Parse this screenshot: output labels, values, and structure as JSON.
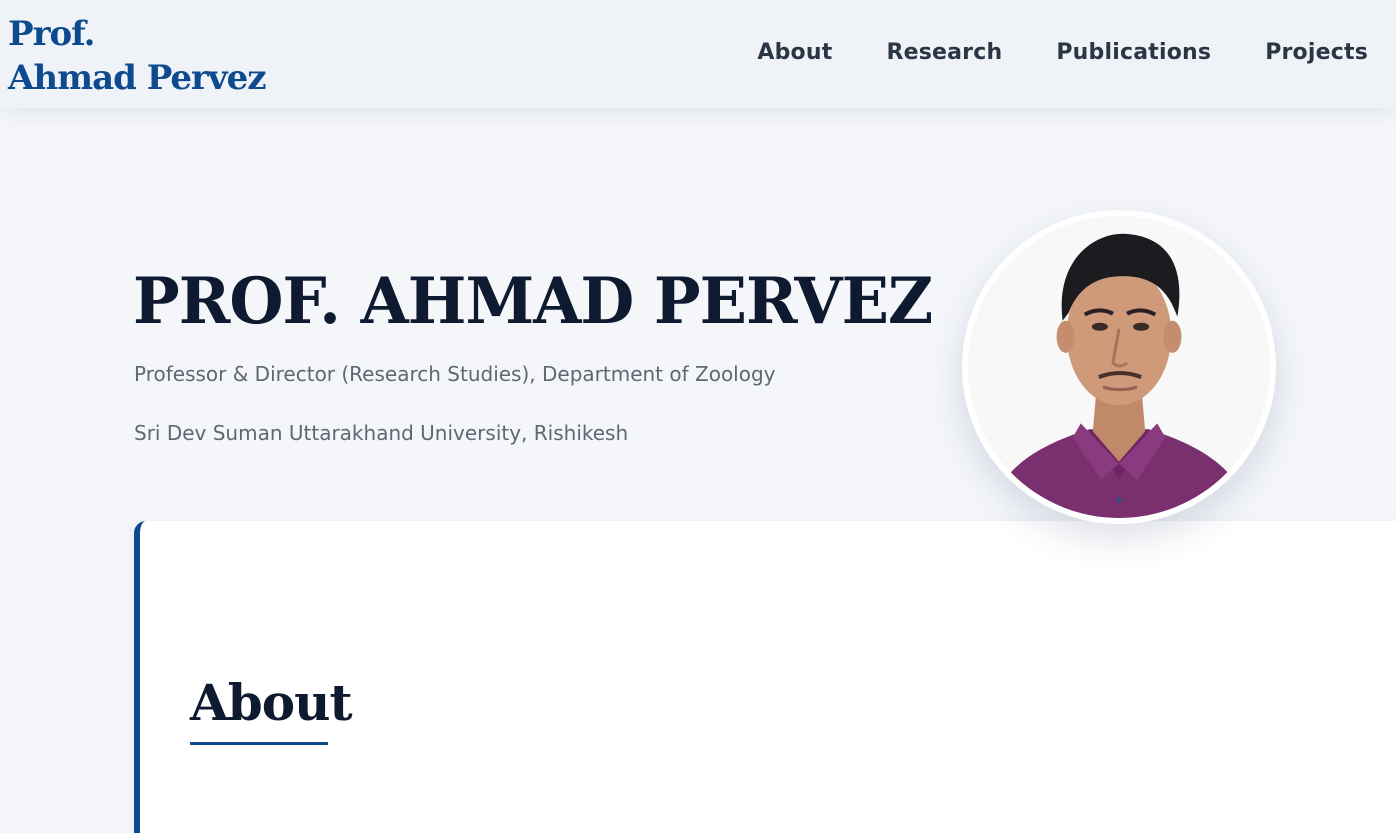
{
  "brand": {
    "line1": "Prof.",
    "line2": "Ahmad Pervez"
  },
  "nav": {
    "items": [
      {
        "label": "About"
      },
      {
        "label": "Research"
      },
      {
        "label": "Publications"
      },
      {
        "label": "Projects"
      }
    ]
  },
  "hero": {
    "name": "PROF. AHMAD PERVEZ",
    "title": "Professor & Director (Research Studies), Department of Zoology",
    "institution": "Sri Dev Suman Uttarakhand University, Rishikesh"
  },
  "about": {
    "heading": "About"
  },
  "colors": {
    "accent": "#0d4a8e",
    "heading": "#0e1a2f",
    "nav_text": "#2b3645",
    "muted_text": "#5f6773",
    "page_bg": "#f4f6fa",
    "navbar_bg": "#eff2f7"
  }
}
